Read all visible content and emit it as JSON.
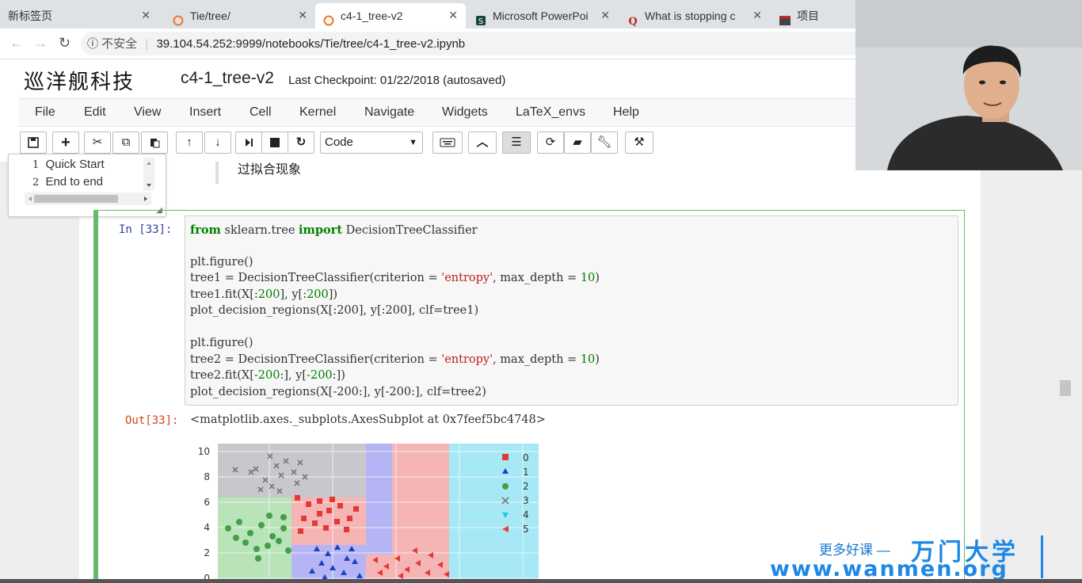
{
  "browser": {
    "tabs": [
      {
        "label": "新标签页"
      },
      {
        "label": "Tie/tree/"
      },
      {
        "label": "c4-1_tree-v2"
      },
      {
        "label": "Microsoft PowerPoi"
      },
      {
        "label": "What is stopping c"
      },
      {
        "label": "项目"
      }
    ],
    "insecure_label": "不安全",
    "url": "39.104.54.252:9999/notebooks/Tie/tree/c4-1_tree-v2.ipynb"
  },
  "header": {
    "logo": "巡洋舰科技",
    "notebook_name": "c4-1_tree-v2",
    "checkpoint": "Last Checkpoint: 01/22/2018 (autosaved)"
  },
  "menu": [
    "File",
    "Edit",
    "View",
    "Insert",
    "Cell",
    "Kernel",
    "Navigate",
    "Widgets",
    "LaTeX_envs",
    "Help"
  ],
  "toolbar": {
    "cell_type": "Code"
  },
  "toc": {
    "items": [
      {
        "num": "1",
        "label": "Quick Start"
      },
      {
        "num": "2",
        "label": "End to end"
      }
    ]
  },
  "markdown_text": "过拟合现象",
  "cell": {
    "in_prompt": "In  [33]:",
    "out_prompt": "Out[33]:",
    "output_text": "<matplotlib.axes._subplots.AxesSubplot at 0x7feef5bc4748>"
  },
  "chart_data": {
    "type": "scatter",
    "title": "",
    "xlabel": "",
    "ylabel": "",
    "y_ticks": [
      "10",
      "8",
      "6",
      "4",
      "2",
      "0"
    ],
    "legend": [
      "0",
      "1",
      "2",
      "3",
      "4",
      "5"
    ],
    "legend_position": "top-right",
    "class_colors": [
      "#e53935",
      "#1e3fbf",
      "#43a047",
      "#888888",
      "#26c6da",
      "#e53935"
    ],
    "region_colors": [
      "#f5b5b5",
      "#b5b5f5",
      "#b9e3b9",
      "#c8c8cc",
      "#a6e8f5"
    ],
    "grid": true
  },
  "watermark": {
    "line1": "更多好课 —",
    "brand": "万门大学",
    "url": "www.wanmen.org"
  }
}
